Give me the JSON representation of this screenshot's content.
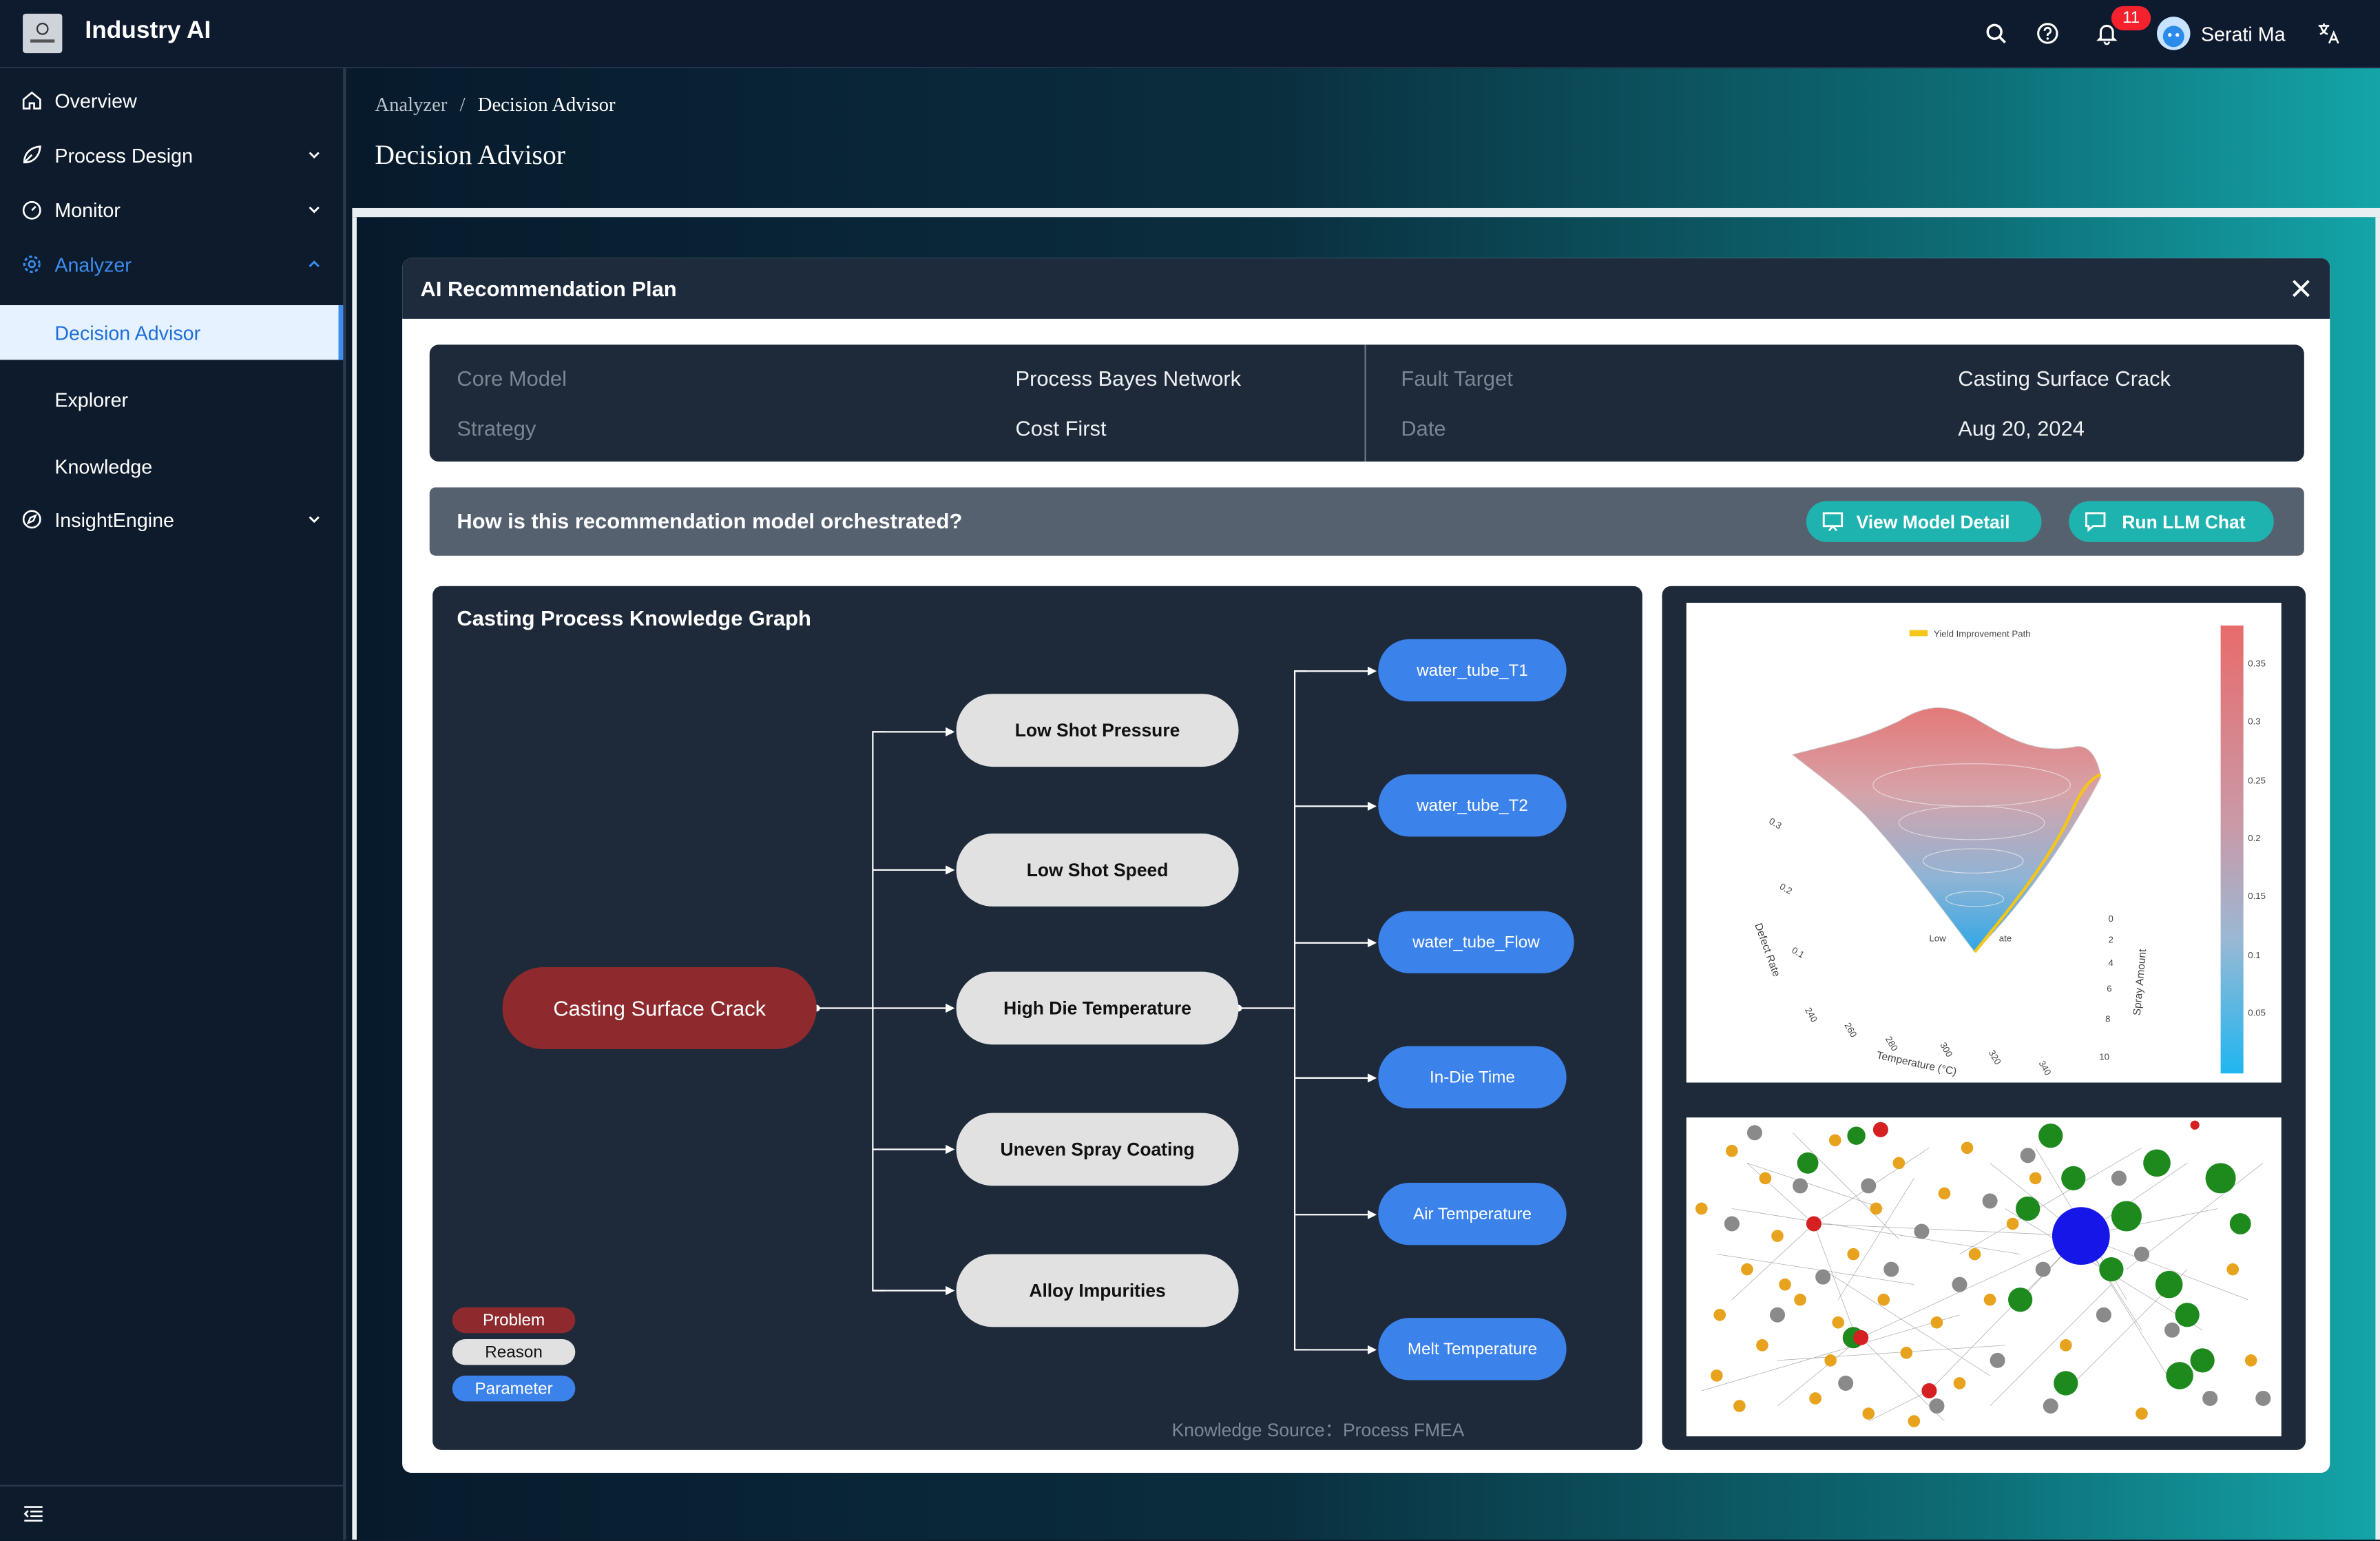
{
  "app": {
    "title": "Industry AI"
  },
  "topbar": {
    "notifications_count": "11",
    "user_name": "Serati Ma"
  },
  "sidebar": {
    "items": [
      {
        "label": "Overview",
        "icon": "home-icon"
      },
      {
        "label": "Process Design",
        "icon": "leaf-icon"
      },
      {
        "label": "Monitor",
        "icon": "dashboard-icon"
      },
      {
        "label": "Analyzer",
        "icon": "gear-icon"
      },
      {
        "label": "InsightEngine",
        "icon": "compass-icon"
      }
    ],
    "analyzer_children": [
      {
        "label": "Decision Advisor",
        "selected": true
      },
      {
        "label": "Explorer"
      },
      {
        "label": "Knowledge"
      }
    ],
    "active_color": "#3b8ef0"
  },
  "breadcrumb": {
    "parent": "Analyzer",
    "separator": "/",
    "current": "Decision Advisor"
  },
  "page": {
    "title": "Decision Advisor"
  },
  "modal": {
    "title": "AI Recommendation Plan",
    "info": {
      "core_model_key": "Core Model",
      "core_model_val": "Process Bayes Network",
      "strategy_key": "Strategy",
      "strategy_val": "Cost First",
      "fault_target_key": "Fault Target",
      "fault_target_val": "Casting Surface Crack",
      "date_key": "Date",
      "date_val": "Aug 20, 2024"
    },
    "question": "How is this recommendation  model orchestrated?",
    "buttons": {
      "view_model": "View Model Detail",
      "run_llm": "Run LLM Chat"
    },
    "graph": {
      "title": "Casting Process Knowledge Graph",
      "problem": "Casting Surface Crack",
      "reasons": [
        "Low Shot Pressure",
        "Low Shot Speed",
        "High Die Temperature",
        "Uneven Spray Coating",
        "Alloy Impurities"
      ],
      "parameters": [
        "water_tube_T1",
        "water_tube_T2",
        "water_tube_Flow",
        "In-Die Time",
        "Air Temperature",
        "Melt Temperature"
      ],
      "legend": {
        "problem": "Problem",
        "reason": "Reason",
        "parameter": "Parameter"
      },
      "source": "Knowledge Source：Process FMEA",
      "colors": {
        "problem": "#8e2a2d",
        "reason": "#e1e1e1",
        "parameter": "#3b82ea"
      }
    },
    "surface_chart": {
      "legend": "Yield Improvement Path",
      "colorbar_ticks": [
        "0.35",
        "0.3",
        "0.25",
        "0.2",
        "0.15",
        "0.1",
        "0.05"
      ],
      "x_label": "Temperature (°C)",
      "x_ticks": [
        "240",
        "260",
        "280",
        "300",
        "320",
        "340"
      ],
      "y_label": "Spray Amount",
      "y_ticks": [
        "0",
        "2",
        "4",
        "6",
        "8",
        "10"
      ],
      "z_label": "Defect Rate",
      "z_ticks": [
        "0.3",
        "0.2",
        "0.1"
      ],
      "inside_label_left": "Low",
      "inside_label_right": "ate"
    }
  }
}
